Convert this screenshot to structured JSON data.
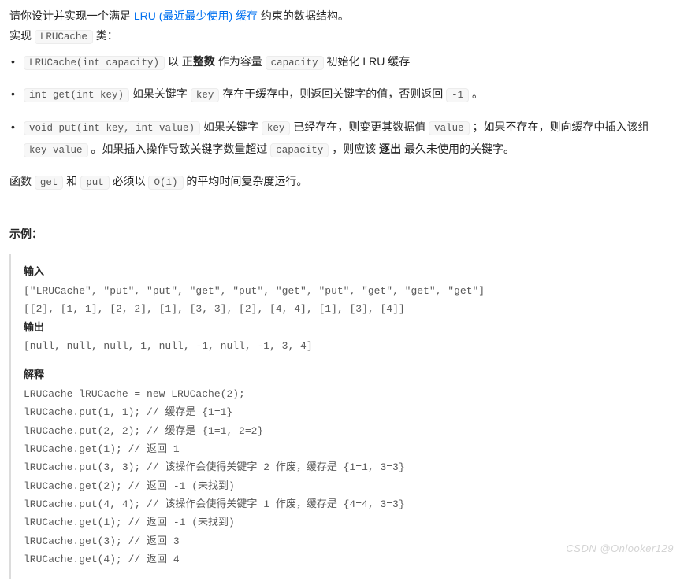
{
  "intro": {
    "p1a": "请你设计并实现一个满足  ",
    "link": "LRU (最近最少使用) 缓存",
    "p1b": " 约束的数据结构。",
    "p2a": "实现 ",
    "code_class": "LRUCache",
    "p2b": " 类："
  },
  "bullets": [
    {
      "pre": "",
      "c1": "LRUCache(int capacity)",
      "t1": " 以 ",
      "b1": "正整数",
      "t2": " 作为容量 ",
      "c2": "capacity",
      "t3": " 初始化 LRU 缓存"
    },
    {
      "c1": "int get(int key)",
      "t1": " 如果关键字 ",
      "c2": "key",
      "t2": " 存在于缓存中，则返回关键字的值，否则返回 ",
      "c3": "-1",
      "t3": " 。"
    },
    {
      "c1": "void put(int key, int value)",
      "t1": " 如果关键字 ",
      "c2": "key",
      "t2": " 已经存在，则变更其数据值 ",
      "c3": "value",
      "t3": " ；如果不存在，则向缓存中插入该组 ",
      "c4": "key-value",
      "t4": " 。如果插入操作导致关键字数量超过 ",
      "c5": "capacity",
      "t5": " ，则应该 ",
      "b1": "逐出",
      "t6": " 最久未使用的关键字。"
    }
  ],
  "complexity": {
    "t1": "函数 ",
    "c1": "get",
    "t2": " 和 ",
    "c2": "put",
    "t3": " 必须以 ",
    "c3": "O(1)",
    "t4": " 的平均时间复杂度运行。"
  },
  "example_heading": "示例：",
  "example": {
    "h_input": "输入",
    "in1": "[\"LRUCache\", \"put\", \"put\", \"get\", \"put\", \"get\", \"put\", \"get\", \"get\", \"get\"]",
    "in2": "[[2], [1, 1], [2, 2], [1], [3, 3], [2], [4, 4], [1], [3], [4]]",
    "h_output": "输出",
    "out1": "[null, null, null, 1, null, -1, null, -1, 3, 4]",
    "h_explain": "解释",
    "e1": "LRUCache lRUCache = new LRUCache(2);",
    "e2": "lRUCache.put(1, 1); // 缓存是 {1=1}",
    "e3": "lRUCache.put(2, 2); // 缓存是 {1=1, 2=2}",
    "e4": "lRUCache.get(1);    // 返回 1",
    "e5": "lRUCache.put(3, 3); // 该操作会使得关键字 2 作废，缓存是 {1=1, 3=3}",
    "e6": "lRUCache.get(2);    // 返回 -1 (未找到)",
    "e7": "lRUCache.put(4, 4); // 该操作会使得关键字 1 作废，缓存是 {4=4, 3=3}",
    "e8": "lRUCache.get(1);    // 返回 -1 (未找到)",
    "e9": "lRUCache.get(3);    // 返回 3",
    "e10": "lRUCache.get(4);    // 返回 4"
  },
  "watermark": "CSDN @Onlooker129"
}
